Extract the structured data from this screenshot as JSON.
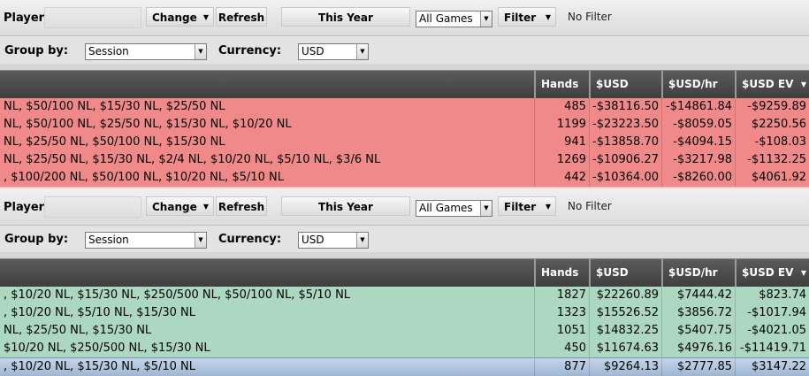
{
  "panels": [
    {
      "toolbar": {
        "player_label": "Player",
        "change_label": "Change",
        "refresh_label": "Refresh",
        "period_label": "This Year",
        "games_value": "All Games",
        "filter_label": "Filter",
        "filter_status": "No Filter"
      },
      "groupbar": {
        "group_by_label": "Group by:",
        "group_by_value": "Session",
        "currency_label": "Currency:",
        "currency_value": "USD"
      },
      "columns": [
        "Hands",
        "$USD",
        "$USD/hr",
        "$USD EV"
      ],
      "rows": [
        {
          "stakes": "NL, $50/100 NL, $15/30 NL, $25/50 NL",
          "hands": "485",
          "usd": "-$38116.50",
          "usd_hr": "-$14861.84",
          "usd_ev": "-$9259.89"
        },
        {
          "stakes": "NL, $50/100 NL, $25/50 NL, $15/30 NL, $10/20 NL",
          "hands": "1199",
          "usd": "-$23223.50",
          "usd_hr": "-$8059.05",
          "usd_ev": "$2250.56"
        },
        {
          "stakes": "NL, $25/50 NL, $50/100 NL, $15/30 NL",
          "hands": "941",
          "usd": "-$13858.70",
          "usd_hr": "-$4094.15",
          "usd_ev": "-$108.03"
        },
        {
          "stakes": "NL, $25/50 NL, $15/30 NL, $2/4 NL, $10/20 NL, $5/10 NL, $3/6 NL",
          "hands": "1269",
          "usd": "-$10906.27",
          "usd_hr": "-$3217.98",
          "usd_ev": "-$1132.25"
        },
        {
          "stakes": ", $100/200 NL, $50/100 NL, $10/20 NL, $5/10 NL",
          "hands": "442",
          "usd": "-$10364.00",
          "usd_hr": "-$8260.00",
          "usd_ev": "$4061.92"
        }
      ]
    },
    {
      "toolbar": {
        "player_label": "Player",
        "change_label": "Change",
        "refresh_label": "Refresh",
        "period_label": "This Year",
        "games_value": "All Games",
        "filter_label": "Filter",
        "filter_status": "No Filter"
      },
      "groupbar": {
        "group_by_label": "Group by:",
        "group_by_value": "Session",
        "currency_label": "Currency:",
        "currency_value": "USD"
      },
      "columns": [
        "Hands",
        "$USD",
        "$USD/hr",
        "$USD EV"
      ],
      "rows": [
        {
          "stakes": ", $10/20 NL, $15/30 NL, $250/500 NL, $50/100 NL, $5/10 NL",
          "hands": "1827",
          "usd": "$22260.89",
          "usd_hr": "$7444.42",
          "usd_ev": "$823.74"
        },
        {
          "stakes": ", $10/20 NL, $5/10 NL, $15/30 NL",
          "hands": "1323",
          "usd": "$15526.52",
          "usd_hr": "$3856.72",
          "usd_ev": "-$1017.94"
        },
        {
          "stakes": "NL, $25/50 NL, $15/30 NL",
          "hands": "1051",
          "usd": "$14832.25",
          "usd_hr": "$5407.75",
          "usd_ev": "-$4021.05"
        },
        {
          "stakes": " $10/20 NL, $250/500 NL, $15/30 NL",
          "hands": "450",
          "usd": "$11674.63",
          "usd_hr": "$4976.16",
          "usd_ev": "-$11419.71"
        },
        {
          "stakes": ", $10/20 NL, $15/30 NL, $5/10 NL",
          "hands": "877",
          "usd": "$9264.13",
          "usd_hr": "$2777.85",
          "usd_ev": "$3147.22"
        }
      ]
    }
  ]
}
